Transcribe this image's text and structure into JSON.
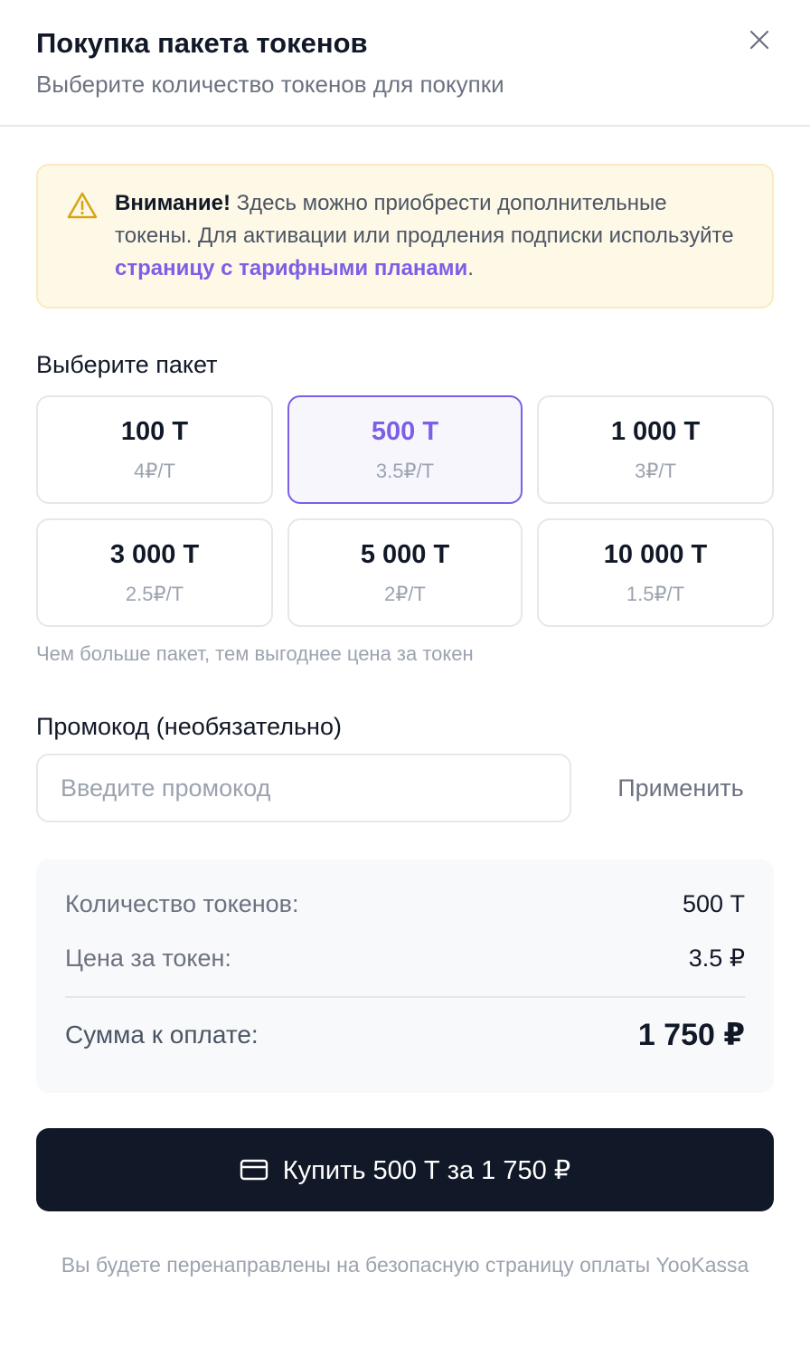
{
  "dialog": {
    "title": "Покупка пакета токенов",
    "subtitle": "Выберите количество токенов для покупки"
  },
  "alert": {
    "strong": "Внимание!",
    "text": " Здесь можно приобрести дополнительные токены. Для активации или продления подписки используйте ",
    "link": "страницу с тарифными планами",
    "end": "."
  },
  "packages": {
    "label": "Выберите пакет",
    "selected_index": 1,
    "items": [
      {
        "amount": "100 Т",
        "price": "4₽/Т"
      },
      {
        "amount": "500 Т",
        "price": "3.5₽/Т"
      },
      {
        "amount": "1 000 Т",
        "price": "3₽/Т"
      },
      {
        "amount": "3 000 Т",
        "price": "2.5₽/Т"
      },
      {
        "amount": "5 000 Т",
        "price": "2₽/Т"
      },
      {
        "amount": "10 000 Т",
        "price": "1.5₽/Т"
      }
    ],
    "hint": "Чем больше пакет, тем выгоднее цена за токен"
  },
  "promo": {
    "label": "Промокод (необязательно)",
    "placeholder": "Введите промокод",
    "value": "",
    "apply_label": "Применить"
  },
  "summary": {
    "tokens_label": "Количество токенов:",
    "tokens_value": "500 Т",
    "price_label": "Цена за токен:",
    "price_value": "3.5 ₽",
    "total_label": "Сумма к оплате:",
    "total_value": "1 750 ₽"
  },
  "buy": {
    "label": "Купить 500 Т за 1 750 ₽",
    "icon": "credit-card-icon"
  },
  "footer": {
    "note": "Вы будете перенаправлены на безопасную страницу оплаты YooKassa"
  },
  "colors": {
    "accent": "#7c5fe6",
    "button_bg": "#111827",
    "alert_bg": "#fef8e7",
    "alert_border": "#fbeac0",
    "warning_icon": "#d9a517"
  }
}
